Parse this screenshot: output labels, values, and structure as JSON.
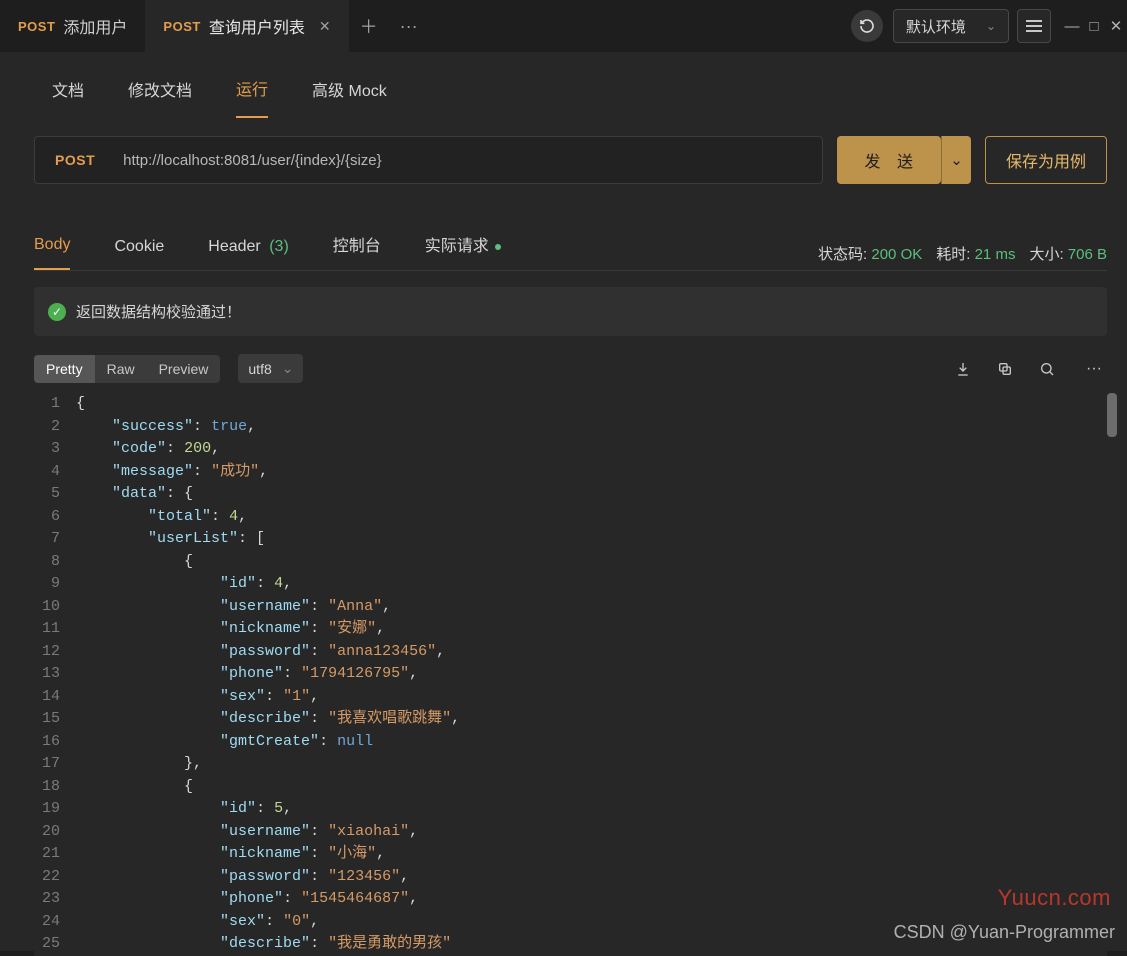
{
  "titlebar": {
    "tabs": [
      {
        "method": "POST",
        "title": "添加用户"
      },
      {
        "method": "POST",
        "title": "查询用户列表"
      }
    ],
    "env_label": "默认环境"
  },
  "subtabs": {
    "doc": "文档",
    "edit_doc": "修改文档",
    "run": "运行",
    "mock": "高级 Mock"
  },
  "request": {
    "method": "POST",
    "url": "http://localhost:8081/user/{index}/{size}",
    "send": "发 送",
    "save_case": "保存为用例"
  },
  "resp_tabs": {
    "body": "Body",
    "cookie": "Cookie",
    "header": "Header",
    "header_count": "(3)",
    "console": "控制台",
    "actual": "实际请求"
  },
  "resp_meta": {
    "status_label": "状态码:",
    "status_value": "200 OK",
    "time_label": "耗时:",
    "time_value": "21 ms",
    "size_label": "大小:",
    "size_value": "706 B"
  },
  "banner": "返回数据结构校验通过！",
  "view_modes": {
    "pretty": "Pretty",
    "raw": "Raw",
    "preview": "Preview"
  },
  "encoding": "utf8",
  "response_json": {
    "success": true,
    "code": 200,
    "message": "成功",
    "data": {
      "total": 4,
      "userList": [
        {
          "id": 4,
          "username": "Anna",
          "nickname": "安娜",
          "password": "anna123456",
          "phone": "1794126795",
          "sex": "1",
          "describe": "我喜欢唱歌跳舞",
          "gmtCreate": null
        },
        {
          "id": 5,
          "username": "xiaohai",
          "nickname": "小海",
          "password": "123456",
          "phone": "1545464687",
          "sex": "0",
          "describe": "我是勇敢的男孩"
        }
      ]
    }
  },
  "watermark1": "Yuucn.com",
  "watermark2": "CSDN @Yuan-Programmer"
}
